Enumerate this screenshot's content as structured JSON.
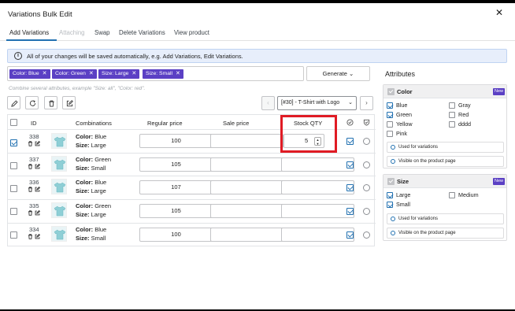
{
  "modal": {
    "title": "Variations Bulk Edit",
    "close_glyph": "✕"
  },
  "tabs": [
    {
      "label": "Add Variations",
      "state": "active"
    },
    {
      "label": "Attaching",
      "state": "disabled"
    },
    {
      "label": "Swap",
      "state": "normal"
    },
    {
      "label": "Delete Variations",
      "state": "normal"
    },
    {
      "label": "View product",
      "state": "normal"
    }
  ],
  "notice": {
    "icon": "info-icon",
    "text": "All of your changes will be saved automatically, e.g. Add Variations, Edit Variations."
  },
  "chips": [
    {
      "label": "Color: Blue"
    },
    {
      "label": "Color: Green"
    },
    {
      "label": "Size: Large"
    },
    {
      "label": "Size: Small"
    }
  ],
  "chip_remove_glyph": "✕",
  "generate_button": {
    "label": "Generate",
    "caret": "⌄"
  },
  "hint": "Combine several attributes, example \"Size: all\", \"Color: red\".",
  "toolbar": {
    "icons": [
      "pencil-icon",
      "refresh-icon",
      "trash-icon",
      "edit-square-icon"
    ],
    "prev_glyph": "‹",
    "next_glyph": "›",
    "product_select": "[#30] - T-Shirt with Logo",
    "product_select_caret": "⌄"
  },
  "table": {
    "headers": {
      "id": "ID",
      "combinations": "Combinations",
      "regular_price": "Regular price",
      "sale_price": "Sale price",
      "stock_qty": "Stock QTY"
    },
    "rows": [
      {
        "id": "338",
        "color_label": "Color:",
        "color": "Blue",
        "size_label": "Size:",
        "size": "Large",
        "regular_price": "100",
        "sale_price": "",
        "stock_qty": "5",
        "selected": true,
        "enabled": true,
        "default": false
      },
      {
        "id": "337",
        "color_label": "Color:",
        "color": "Green",
        "size_label": "Size:",
        "size": "Small",
        "regular_price": "105",
        "sale_price": "",
        "stock_qty": "",
        "selected": false,
        "enabled": true,
        "default": false
      },
      {
        "id": "336",
        "color_label": "Color:",
        "color": "Blue",
        "size_label": "Size:",
        "size": "Large",
        "regular_price": "107",
        "sale_price": "",
        "stock_qty": "",
        "selected": false,
        "enabled": true,
        "default": false
      },
      {
        "id": "335",
        "color_label": "Color:",
        "color": "Green",
        "size_label": "Size:",
        "size": "Large",
        "regular_price": "105",
        "sale_price": "",
        "stock_qty": "",
        "selected": false,
        "enabled": true,
        "default": false
      },
      {
        "id": "334",
        "color_label": "Color:",
        "color": "Blue",
        "size_label": "Size:",
        "size": "Small",
        "regular_price": "100",
        "sale_price": "",
        "stock_qty": "",
        "selected": false,
        "enabled": true,
        "default": false
      }
    ]
  },
  "attributes_panel": {
    "title": "Attributes",
    "color": {
      "name": "Color",
      "badge": "New",
      "terms": [
        {
          "label": "Blue",
          "checked": true
        },
        {
          "label": "Gray",
          "checked": false
        },
        {
          "label": "Green",
          "checked": true
        },
        {
          "label": "Red",
          "checked": false
        },
        {
          "label": "Yellow",
          "checked": false
        },
        {
          "label": "dddd",
          "checked": false
        },
        {
          "label": "Pink",
          "checked": false
        }
      ],
      "used_for_variations": "Used for variations",
      "visible_on_product_page": "Visible on the product page"
    },
    "size": {
      "name": "Size",
      "badge": "New",
      "terms": [
        {
          "label": "Large",
          "checked": true
        },
        {
          "label": "Medium",
          "checked": false
        },
        {
          "label": "Small",
          "checked": true
        }
      ],
      "used_for_variations": "Used for variations",
      "visible_on_product_page": "Visible on the product page"
    }
  },
  "colors": {
    "chip_bg": "#5b40c4",
    "accent": "#2271b1",
    "highlight_box": "#e01b24",
    "notice_bg": "#e7eefb"
  }
}
